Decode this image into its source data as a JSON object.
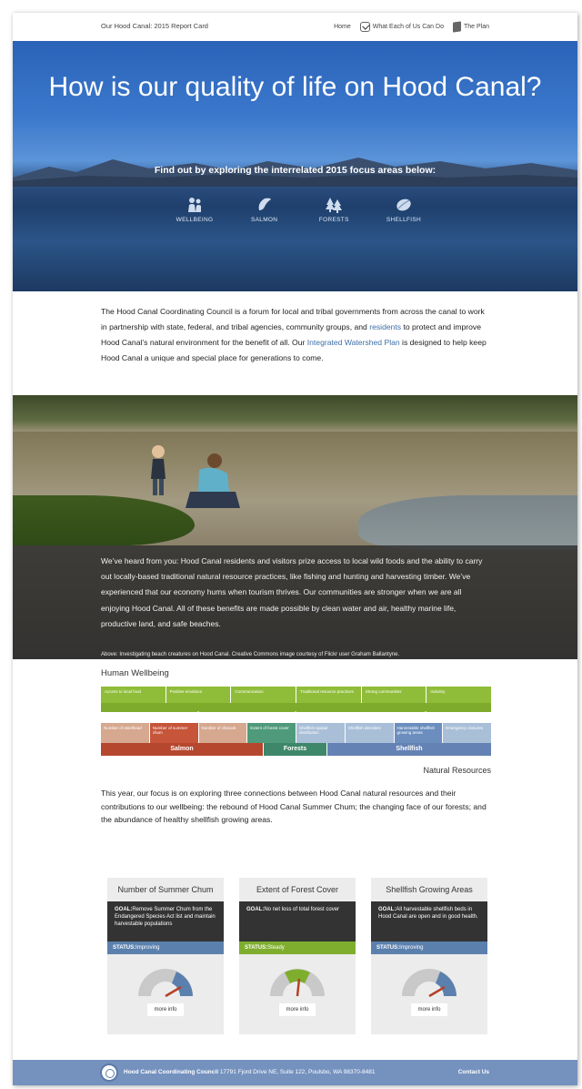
{
  "header": {
    "site_title": "Our Hood Canal: 2015 Report Card",
    "nav": [
      "Home",
      "What Each of Us Can Do",
      "The Plan"
    ]
  },
  "hero": {
    "title": "How is our quality of life on Hood Canal?",
    "subtitle": "Find out by exploring the interrelated 2015 focus areas below:",
    "focus_areas": [
      "WELLBEING",
      "SALMON",
      "FORESTS",
      "SHELLFISH"
    ]
  },
  "intro": {
    "part1": "The Hood Canal Coordinating Council is a forum for local and tribal governments from across the canal to work in partnership with state, federal, and tribal agencies, community groups, and ",
    "link1": "residents",
    "part2": " to protect and improve Hood Canal’s natural environment for the benefit of all. Our ",
    "link2": "Integrated Watershed Plan",
    "part3": " is designed to help keep Hood Canal a unique and special place for generations to come."
  },
  "photo": {
    "overlay_text": "We’ve heard from you: Hood Canal residents and visitors prize access to local wild foods and the ability to carry out locally-based traditional natural resource practices, like fishing and hunting and harvesting timber. We’ve experienced that our economy hums when tourism thrives. Our communities are stronger when we are all enjoying Hood Canal. All of these benefits are made possible by clean water and air, healthy marine life, productive land, and safe beaches.",
    "caption": "Above: Investigating beach creatures on Hood Canal. Creative Commons image courtesy of Flickr user Graham Ballantyne."
  },
  "diagram": {
    "title": "Human Wellbeing",
    "wellbeing": [
      "Access to local food",
      "Positive emotions",
      "Communication",
      "Traditional resource practices",
      "Strong communities",
      "Industry"
    ],
    "resources": [
      {
        "label": "Number of steelhead",
        "color": "#d6a890"
      },
      {
        "label": "Number of summer chum",
        "color": "#c6553a"
      },
      {
        "label": "Number of chinook",
        "color": "#d6a890"
      },
      {
        "label": "Extent of forest cover",
        "color": "#4f9a7a"
      },
      {
        "label": "Shellfish spatial distribution",
        "color": "#a9bfd8"
      },
      {
        "label": "Shellfish densities",
        "color": "#a9bfd8"
      },
      {
        "label": "Harvestable shellfish growing areas",
        "color": "#6b8ebf"
      },
      {
        "label": "Emergency closures",
        "color": "#a9bfd8"
      }
    ],
    "groups": [
      {
        "label": "Salmon",
        "color": "#b6472f"
      },
      {
        "label": "Forests",
        "color": "#3e876a"
      },
      {
        "label": "Shellfish",
        "color": "#6482b4"
      }
    ],
    "natural_resources_label": "Natural Resources"
  },
  "focus_text": "This year, our focus is on exploring three connections between Hood Canal natural resources and their contributions to our wellbeing: the rebound of Hood Canal Summer Chum; the changing face of our forests; and the abundance of healthy shellfish growing areas.",
  "cards": [
    {
      "title": "Number of Summer Chum",
      "goal_label": "GOAL:",
      "goal": "Remove Summer Chum from the Endangered Species Act list and maintain harvestable populations",
      "status_label": "STATUS:",
      "status": "Improving",
      "status_color": "#5b80ad",
      "gauge_color": "#5b80ad",
      "more": "more info"
    },
    {
      "title": "Extent of Forest Cover",
      "goal_label": "GOAL:",
      "goal": "No net loss of total forest cover",
      "status_label": "STATUS:",
      "status": "Steady",
      "status_color": "#7fae2f",
      "gauge_color": "#7fae2f",
      "more": "more info"
    },
    {
      "title": "Shellfish Growing Areas",
      "goal_label": "GOAL:",
      "goal": "All harvestable shellfish beds in Hood Canal are open and in good health.",
      "status_label": "STATUS:",
      "status": "Improving",
      "status_color": "#5b80ad",
      "gauge_color": "#5b80ad",
      "more": "more info"
    }
  ],
  "footer": {
    "org": "Hood Canal Coordinating Council",
    "address": "17791 Fjord Drive NE, Suite 122, Poulsbo, WA 98370-8481",
    "contact": "Contact Us"
  }
}
